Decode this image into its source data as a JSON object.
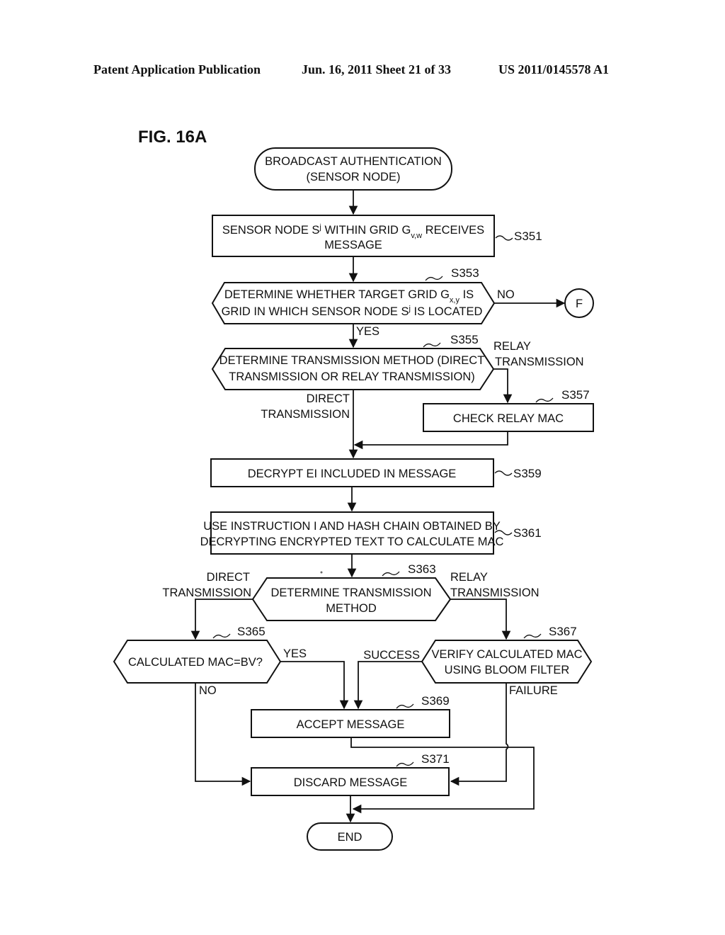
{
  "header": {
    "publication": "Patent Application Publication",
    "date_sheet": "Jun. 16, 2011  Sheet 21 of 33",
    "number": "US 2011/0145578 A1"
  },
  "figure": {
    "label": "FIG. 16A"
  },
  "nodes": {
    "start": {
      "line1": "BROADCAST AUTHENTICATION",
      "line2": "(SENSOR NODE)"
    },
    "s351": {
      "step": "S351",
      "line1_a": "SENSOR NODE S",
      "line1_sup": "j",
      "line1_b": " WITHIN GRID G",
      "line1_sub": "v,w",
      "line1_c": " RECEIVES",
      "line2": "MESSAGE"
    },
    "s353": {
      "step": "S353",
      "line1_a": "DETERMINE WHETHER TARGET GRID G",
      "line1_sub": "x,y",
      "line1_b": " IS",
      "line2_a": "GRID IN WHICH SENSOR NODE S",
      "line2_sup": "j",
      "line2_b": " IS LOCATED"
    },
    "connector_f": {
      "label": "F"
    },
    "s355": {
      "step": "S355",
      "line1": "DETERMINE TRANSMISSION METHOD (DIRECT",
      "line2": "TRANSMISSION OR RELAY TRANSMISSION)"
    },
    "s357": {
      "step": "S357",
      "line1": "CHECK RELAY MAC"
    },
    "s359": {
      "step": "S359",
      "line1": "DECRYPT EI INCLUDED IN MESSAGE"
    },
    "s361": {
      "step": "S361",
      "line1": "USE INSTRUCTION I AND HASH CHAIN OBTAINED BY",
      "line2": "DECRYPTING ENCRYPTED TEXT TO CALCULATE MAC"
    },
    "s363": {
      "step": "S363",
      "line1": "DETERMINE TRANSMISSION",
      "line2": "METHOD"
    },
    "s365": {
      "step": "S365",
      "line1": "CALCULATED MAC=BV?"
    },
    "s367": {
      "step": "S367",
      "line1": "VERIFY CALCULATED MAC",
      "line2": "USING BLOOM FILTER"
    },
    "s369": {
      "step": "S369",
      "line1": "ACCEPT MESSAGE"
    },
    "s371": {
      "step": "S371",
      "line1": "DISCARD MESSAGE"
    },
    "end": {
      "line1": "END"
    }
  },
  "edge_labels": {
    "s353_no": "NO",
    "s353_yes": "YES",
    "s355_relay_1": "RELAY",
    "s355_relay_2": "TRANSMISSION",
    "s355_direct_1": "DIRECT",
    "s355_direct_2": "TRANSMISSION",
    "s363_direct_1": "DIRECT",
    "s363_direct_2": "TRANSMISSION",
    "s363_relay_1": "RELAY",
    "s363_relay_2": "TRANSMISSION",
    "s365_yes": "YES",
    "s365_no": "NO",
    "s367_success": "SUCCESS",
    "s367_failure": "FAILURE"
  }
}
